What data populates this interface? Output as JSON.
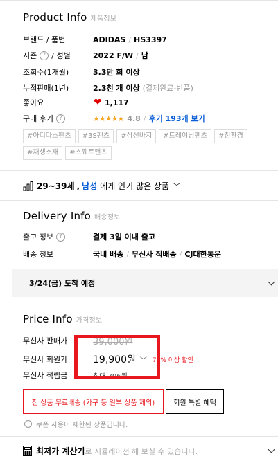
{
  "product_info": {
    "title": "Product Info",
    "subtitle": "제품정보",
    "brand_label": "브랜드 / 품번",
    "brand": "ADIDAS",
    "code": "HS3397",
    "season_label": "시즌",
    "gender_label": "/ 성별",
    "season": "2022 F/W",
    "gender": "남",
    "views_label": "조회수(1개월)",
    "views": "3.3만 회 이상",
    "sales_label": "누적판매(1년)",
    "sales": "2.3천 개 이상",
    "sales_note": "(결제완료-반품)",
    "likes_label": "좋아요",
    "likes": "1,117",
    "review_label": "구매 후기",
    "stars": "★★★★★",
    "rating": "4.8",
    "review_link": "후기 193개 보기",
    "tags": [
      "#아디다스팬츠",
      "#3S팬츠",
      "#삼선바지",
      "#트레이닝팬츠",
      "#친환경",
      "#재생소재",
      "#스웨트팬츠"
    ]
  },
  "popularity": {
    "age": "29~39세",
    "gender": "남성",
    "text": "에게 인기 많은 상품"
  },
  "delivery_info": {
    "title": "Delivery Info",
    "subtitle": "배송정보",
    "dispatch_label": "출고 정보",
    "dispatch": "결제 3일 이내 출고",
    "shipping_label": "배송 정보",
    "ship_domestic": "국내 배송",
    "ship_direct": "무신사 직배송",
    "ship_courier": "CJ대한통운",
    "eta": "3/24(금) 도착 예정"
  },
  "price_info": {
    "title": "Price Info",
    "subtitle": "가격정보",
    "sale_label": "무신사 판매가",
    "sale_price": "39,000원",
    "member_label": "무신사 회원가",
    "member_price": "19,900원",
    "discount": "71% 이상 할인",
    "points_label": "무신사 적립금",
    "points": "최대 796원",
    "free_shipping_button": "전 상품 무료배송 (가구 등 일부 상품 제외)",
    "member_benefit_button": "회원 특별 혜택",
    "coupon_notice": "쿠폰 사용이 제한된 상품입니다."
  },
  "calculator": {
    "title": "최저가 계산기",
    "text": "로 시뮬레이션 해 보실 수 있습니다."
  },
  "colors": {
    "accent_red": "#e8161d",
    "link_blue": "#0a5fd6",
    "star": "#f5a623"
  }
}
